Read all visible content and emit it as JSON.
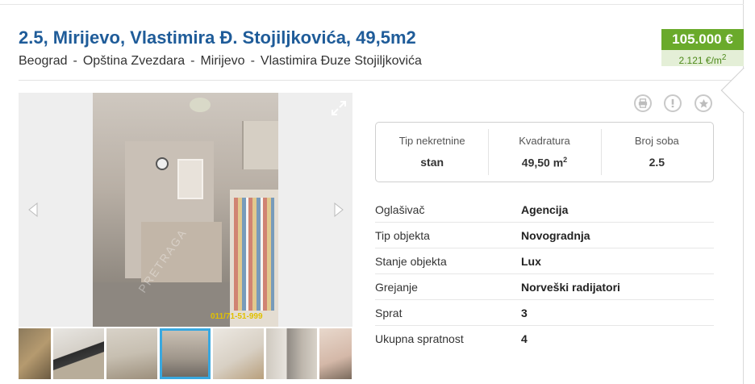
{
  "listing": {
    "title": "2.5, Mirijevo, Vlastimira Đ. Stojiljkovića, 49,5m2",
    "breadcrumb": [
      "Beograd",
      "Opština Zvezdara",
      "Mirijevo",
      "Vlastimira Đuze Stojiljkovića"
    ],
    "breadcrumb_separator": "-"
  },
  "price": {
    "total": "105.000 €",
    "per_sqm": "2.121 €/m",
    "per_sqm_sup": "2"
  },
  "gallery": {
    "photo_caption": "011/71-51-999",
    "watermark": "PRETRAGA",
    "thumbnail_count": 7,
    "active_thumbnail": 4,
    "icons": {
      "prev": "chevron-left-icon",
      "next": "chevron-right-icon",
      "expand": "expand-icon"
    }
  },
  "actions": {
    "icons": [
      "print-icon",
      "report-icon",
      "favorite-icon"
    ]
  },
  "summary": [
    {
      "label": "Tip nekretnine",
      "value": "stan"
    },
    {
      "label": "Kvadratura",
      "value": "49,50 m",
      "sup": "2"
    },
    {
      "label": "Broj soba",
      "value": "2.5"
    }
  ],
  "details": [
    {
      "label": "Oglašivač",
      "value": "Agencija"
    },
    {
      "label": "Tip objekta",
      "value": "Novogradnja"
    },
    {
      "label": "Stanje objekta",
      "value": "Lux"
    },
    {
      "label": "Grejanje",
      "value": "Norveški radijatori"
    },
    {
      "label": "Sprat",
      "value": "3"
    },
    {
      "label": "Ukupna spratnost",
      "value": "4"
    }
  ],
  "colors": {
    "title": "#1f5c99",
    "price_bg": "#6aaa2b",
    "price_sqm_bg": "#e4efd7",
    "active_thumb_border": "#39a8e0"
  }
}
